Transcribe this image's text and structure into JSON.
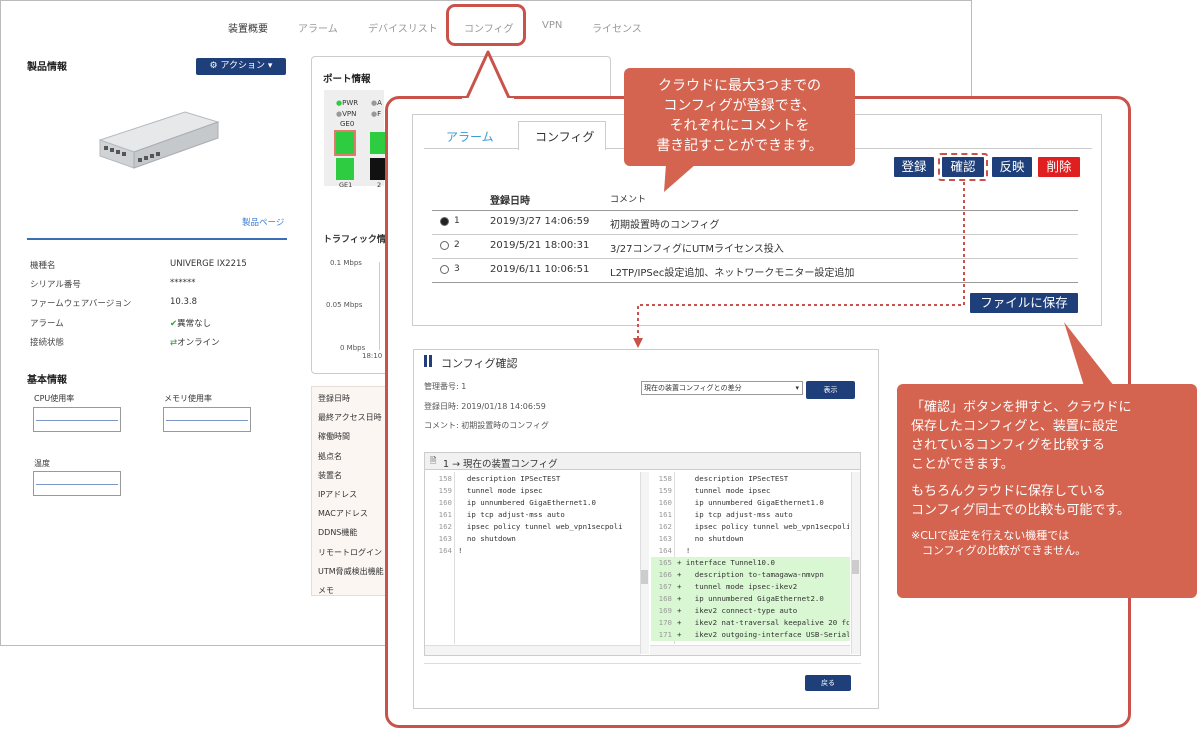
{
  "top_tabs": [
    "装置概要",
    "アラーム",
    "デバイスリスト",
    "コンフィグ",
    "VPN",
    "ライセンス"
  ],
  "product": {
    "heading": "製品情報",
    "action_label": "アクション",
    "product_page_link": "製品ページ",
    "fields": [
      {
        "label": "機種名",
        "value": "UNIVERGE IX2215"
      },
      {
        "label": "シリアル番号",
        "value": "******"
      },
      {
        "label": "ファームウェアバージョン",
        "value": "10.3.8"
      },
      {
        "label": "アラーム",
        "value": "異常なし"
      },
      {
        "label": "接続状態",
        "value": "オンライン"
      }
    ]
  },
  "basic": {
    "heading": "基本情報",
    "cpu": "CPU使用率",
    "memory": "メモリ使用率",
    "temp": "温度"
  },
  "port_info": {
    "heading": "ポート情報",
    "legend": [
      "PWR",
      "VPN",
      "GE0",
      "A",
      "F"
    ],
    "labels": [
      "GE1",
      "2"
    ]
  },
  "traffic": {
    "heading": "トラフィック情",
    "ticks": [
      "0.1 Mbps",
      "0.05 Mbps",
      "0 Mbps"
    ],
    "x_tick": "18:10"
  },
  "details_labels": [
    "登録日時",
    "最終アクセス日時",
    "稼働時間",
    "拠点名",
    "装置名",
    "IPアドレス",
    "MACアドレス",
    "DDNS機能",
    "リモートログイン",
    "UTM脅威検出機能",
    "メモ"
  ],
  "config_panel": {
    "tabs": [
      "アラーム",
      "コンフィグ"
    ],
    "buttons": {
      "register": "登録",
      "confirm": "確認",
      "apply": "反映",
      "delete": "削除",
      "save_file": "ファイルに保存"
    },
    "col_date": "登録日時",
    "col_comment": "コメント",
    "rows": [
      {
        "num": "1",
        "date": "2019/3/27 14:06:59",
        "comment": "初期設置時のコンフィグ",
        "selected": true
      },
      {
        "num": "2",
        "date": "2019/5/21 18:00:31",
        "comment": "3/27コンフィグにUTMライセンス投入",
        "selected": false
      },
      {
        "num": "3",
        "date": "2019/6/11 10:06:51",
        "comment": "L2TP/IPSec設定追加、ネットワークモニター設定追加",
        "selected": false
      }
    ]
  },
  "dialog": {
    "title": "コンフィグ確認",
    "mgmt_no": "管理番号: 1",
    "reg_date": "登録日時: 2019/01/18 14:06:59",
    "comment": "コメント: 初期設置時のコンフィグ",
    "compare_select": "現在の装置コンフィグとの差分",
    "show_button": "表示",
    "diff_header": "1 → 現在の装置コンフィグ",
    "back_button": "戻る",
    "left_lines": [
      {
        "n": "158",
        "t": "  description IPSecTEST"
      },
      {
        "n": "159",
        "t": "  tunnel mode ipsec"
      },
      {
        "n": "160",
        "t": "  ip unnumbered GigaEthernet1.0"
      },
      {
        "n": "161",
        "t": "  ip tcp adjust-mss auto"
      },
      {
        "n": "162",
        "t": "  ipsec policy tunnel web_vpn1secpoli"
      },
      {
        "n": "163",
        "t": "  no shutdown"
      },
      {
        "n": "164",
        "t": "!"
      }
    ],
    "right_lines": [
      {
        "n": "158",
        "t": "    description IPSecTEST",
        "add": false
      },
      {
        "n": "159",
        "t": "    tunnel mode ipsec",
        "add": false
      },
      {
        "n": "160",
        "t": "    ip unnumbered GigaEthernet1.0",
        "add": false
      },
      {
        "n": "161",
        "t": "    ip tcp adjust-mss auto",
        "add": false
      },
      {
        "n": "162",
        "t": "    ipsec policy tunnel web_vpn1secpoli",
        "add": false
      },
      {
        "n": "163",
        "t": "    no shutdown",
        "add": false
      },
      {
        "n": "164",
        "t": "  !",
        "add": false
      },
      {
        "n": "165",
        "t": "+ interface Tunnel10.0",
        "add": true
      },
      {
        "n": "166",
        "t": "+   description to-tamagawa-nmvpn",
        "add": true
      },
      {
        "n": "167",
        "t": "+   tunnel mode ipsec-ikev2",
        "add": true
      },
      {
        "n": "168",
        "t": "+   ip unnumbered GigaEthernet2.0",
        "add": true
      },
      {
        "n": "169",
        "t": "+   ikev2 connect-type auto",
        "add": true
      },
      {
        "n": "170",
        "t": "+   ikev2 nat-traversal keepalive 20 fo",
        "add": true
      },
      {
        "n": "171",
        "t": "+   ikev2 outgoing-interface USB-Serial",
        "add": true
      }
    ]
  },
  "callouts": {
    "top": [
      "クラウドに最大3つまでの",
      "コンフィグが登録でき、",
      "それぞれにコメントを",
      "書き記すことができます。"
    ],
    "right_p1": [
      "「確認」ボタンを押すと、クラウドに",
      "保存したコンフィグと、装置に設定",
      "されているコンフィグを比較する",
      "ことができます。"
    ],
    "right_p2": [
      "もちろんクラウドに保存している",
      "コンフィグ同士での比較も可能です。"
    ],
    "right_note": [
      "※CLIで設定を行えない機種では",
      "　コンフィグの比較ができません。"
    ]
  },
  "colors": {
    "accent_red": "#c9534a",
    "callout": "#d4634f",
    "navy": "#1e3f7a",
    "diff_add": "#d9f7d2",
    "status_green": "#2ca02c"
  }
}
